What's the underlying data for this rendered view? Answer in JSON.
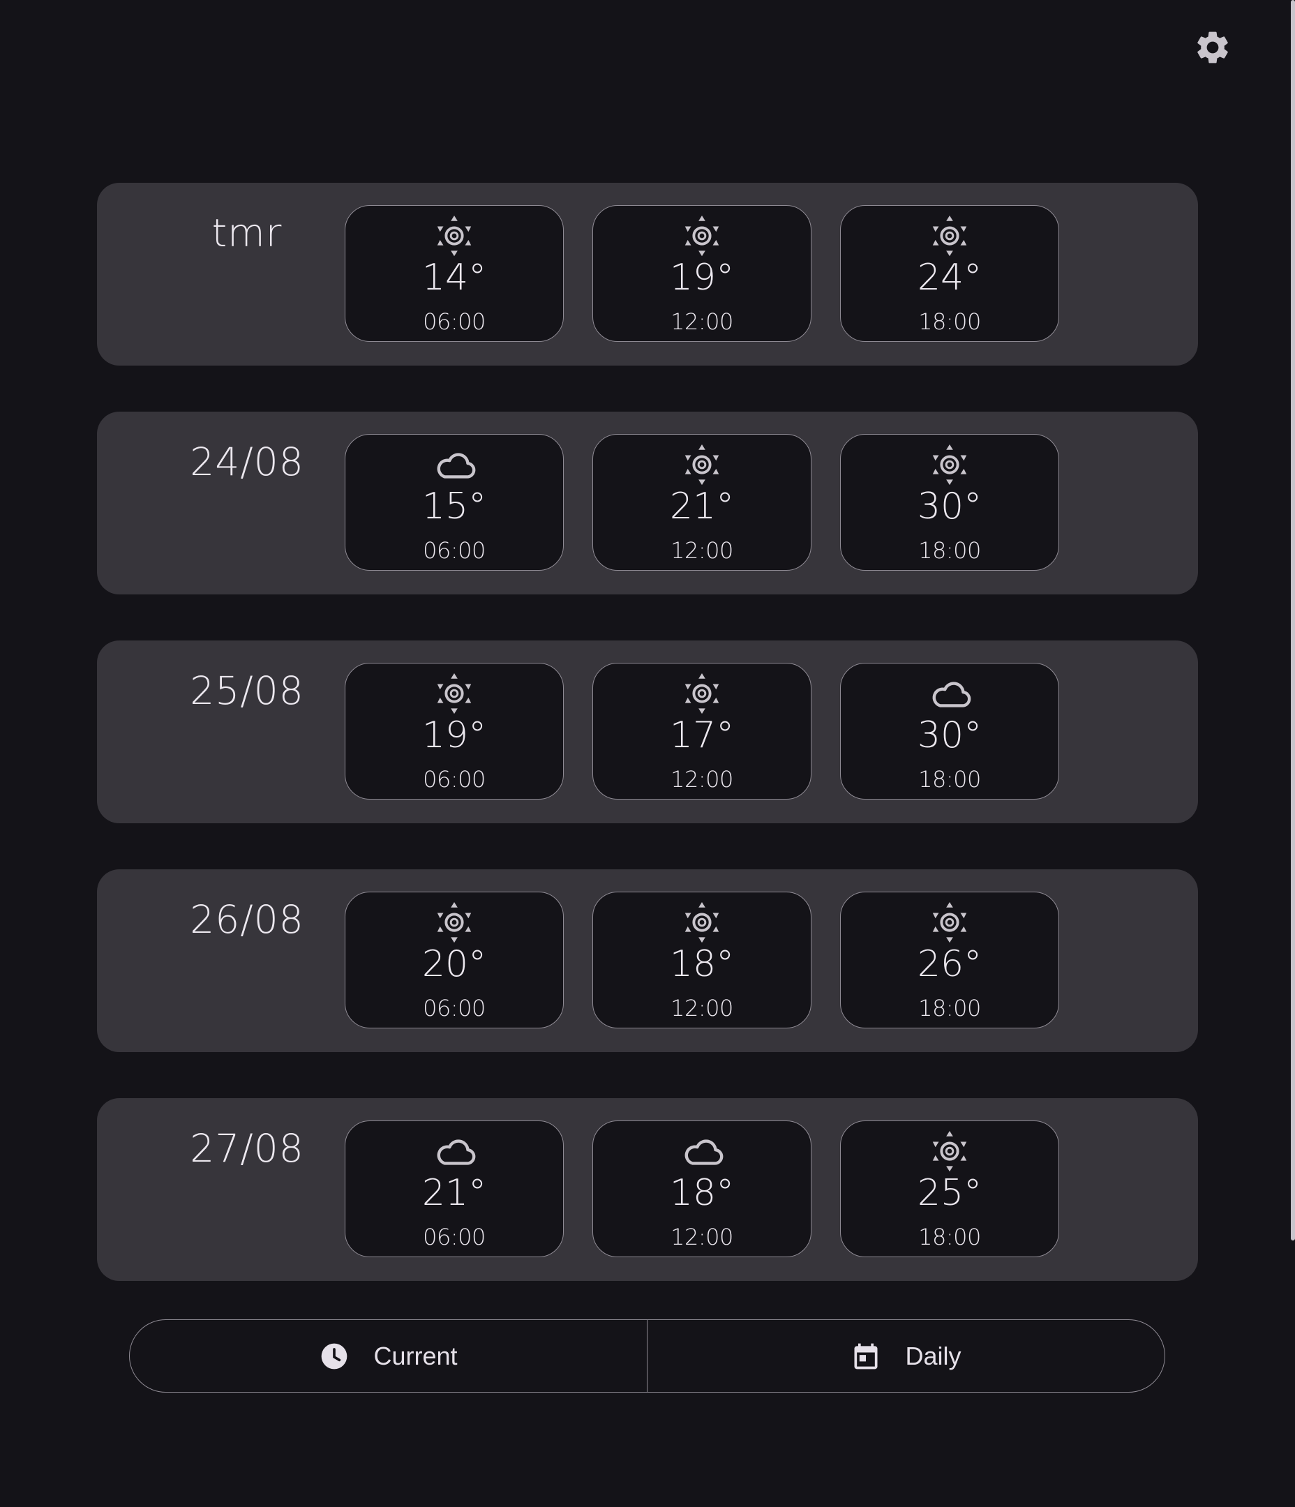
{
  "colors": {
    "background": "#141318",
    "card": "#37353b",
    "slot_bg": "#141318",
    "outline": "#8e8a93",
    "text": "#ece8ef",
    "icon": "#c9c5cc"
  },
  "header": {
    "settings_icon": "gear-icon"
  },
  "forecast": {
    "days": [
      {
        "label": "tmr",
        "slots": [
          {
            "icon": "sun-icon",
            "temp": "14°",
            "time": "06:00"
          },
          {
            "icon": "sun-icon",
            "temp": "19°",
            "time": "12:00"
          },
          {
            "icon": "sun-icon",
            "temp": "24°",
            "time": "18:00"
          }
        ]
      },
      {
        "label": "24/08",
        "slots": [
          {
            "icon": "cloud-icon",
            "temp": "15°",
            "time": "06:00"
          },
          {
            "icon": "sun-icon",
            "temp": "21°",
            "time": "12:00"
          },
          {
            "icon": "sun-icon",
            "temp": "30°",
            "time": "18:00"
          }
        ]
      },
      {
        "label": "25/08",
        "slots": [
          {
            "icon": "sun-icon",
            "temp": "19°",
            "time": "06:00"
          },
          {
            "icon": "sun-icon",
            "temp": "17°",
            "time": "12:00"
          },
          {
            "icon": "cloud-icon",
            "temp": "30°",
            "time": "18:00"
          }
        ]
      },
      {
        "label": "26/08",
        "slots": [
          {
            "icon": "sun-icon",
            "temp": "20°",
            "time": "06:00"
          },
          {
            "icon": "sun-icon",
            "temp": "18°",
            "time": "12:00"
          },
          {
            "icon": "sun-icon",
            "temp": "26°",
            "time": "18:00"
          }
        ]
      },
      {
        "label": "27/08",
        "slots": [
          {
            "icon": "cloud-icon",
            "temp": "21°",
            "time": "06:00"
          },
          {
            "icon": "cloud-icon",
            "temp": "18°",
            "time": "12:00"
          },
          {
            "icon": "sun-icon",
            "temp": "25°",
            "time": "18:00"
          }
        ]
      }
    ]
  },
  "nav": {
    "current_label": "Current",
    "current_icon": "clock-icon",
    "daily_label": "Daily",
    "daily_icon": "calendar-icon"
  }
}
